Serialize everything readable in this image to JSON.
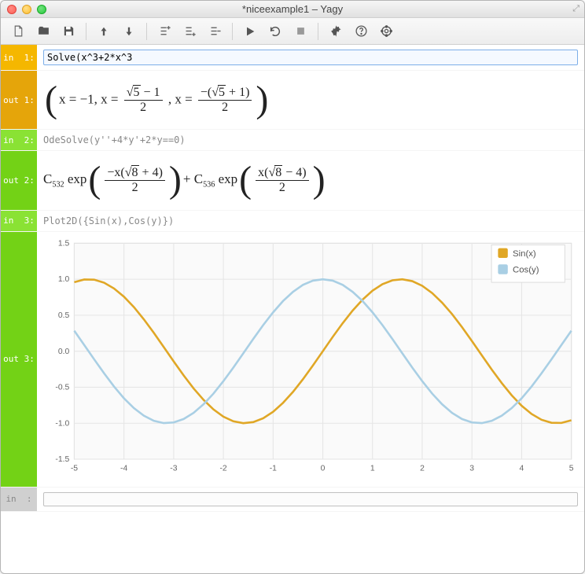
{
  "window": {
    "title": "*niceexample1 – Yagy"
  },
  "toolbar": {
    "new": "New",
    "open": "Open",
    "save": "Save",
    "up": "Up",
    "down": "Down",
    "insabove": "Insert Above",
    "insbelow": "Insert Below",
    "delcell": "Delete Cell",
    "run": "Run",
    "reload": "Reload",
    "stop": "Stop",
    "settings": "Settings",
    "help": "Help",
    "target": "Kernel"
  },
  "cells": {
    "in1_label": "in  1:",
    "in1_value": "Solve(x^3+2*x^3",
    "out1_label": "out 1:",
    "in2_label": "in  2:",
    "in2_value": "OdeSolve(y''+4*y'+2*y==0)",
    "out2_label": "out 2:",
    "in3_label": "in  3:",
    "in3_value": "Plot2D({Sin(x),Cos(y)})",
    "out3_label": "out 3:",
    "in_next_label": "in  :"
  },
  "chart_data": {
    "type": "line",
    "x": [
      -5,
      -4.8,
      -4.6,
      -4.4,
      -4.2,
      -4,
      -3.8,
      -3.6,
      -3.4,
      -3.2,
      -3,
      -2.8,
      -2.6,
      -2.4,
      -2.2,
      -2,
      -1.8,
      -1.6,
      -1.4,
      -1.2,
      -1,
      -0.8,
      -0.6,
      -0.4,
      -0.2,
      0,
      0.2,
      0.4,
      0.6,
      0.8,
      1,
      1.2,
      1.4,
      1.6,
      1.8,
      2,
      2.2,
      2.4,
      2.6,
      2.8,
      3,
      3.2,
      3.4,
      3.6,
      3.8,
      4,
      4.2,
      4.4,
      4.6,
      4.8,
      5
    ],
    "series": [
      {
        "name": "Sin(x)",
        "color": "#e0a726",
        "values": [
          0.959,
          0.996,
          0.994,
          0.952,
          0.872,
          0.757,
          0.612,
          0.443,
          0.256,
          0.058,
          -0.141,
          -0.335,
          -0.516,
          -0.675,
          -0.808,
          -0.909,
          -0.974,
          -1.0,
          -0.985,
          -0.932,
          -0.841,
          -0.717,
          -0.565,
          -0.389,
          -0.199,
          0.0,
          0.199,
          0.389,
          0.565,
          0.717,
          0.841,
          0.932,
          0.985,
          1.0,
          0.974,
          0.909,
          0.808,
          0.675,
          0.516,
          0.335,
          0.141,
          -0.058,
          -0.256,
          -0.443,
          -0.612,
          -0.757,
          -0.872,
          -0.952,
          -0.994,
          -0.996,
          -0.959
        ]
      },
      {
        "name": "Cos(y)",
        "color": "#a9cfe4",
        "values": [
          0.284,
          0.087,
          -0.112,
          -0.307,
          -0.49,
          -0.654,
          -0.79,
          -0.896,
          -0.967,
          -0.998,
          -0.99,
          -0.942,
          -0.857,
          -0.737,
          -0.589,
          -0.416,
          -0.227,
          -0.029,
          0.17,
          0.362,
          0.54,
          0.697,
          0.825,
          0.921,
          0.98,
          1.0,
          0.98,
          0.921,
          0.825,
          0.697,
          0.54,
          0.362,
          0.17,
          -0.029,
          -0.227,
          -0.416,
          -0.589,
          -0.737,
          -0.857,
          -0.942,
          -0.99,
          -0.998,
          -0.967,
          -0.896,
          -0.79,
          -0.654,
          -0.49,
          -0.307,
          -0.112,
          0.087,
          0.284
        ]
      }
    ],
    "xlim": [
      -5,
      5
    ],
    "ylim": [
      -1.5,
      1.5
    ],
    "xticks": [
      -5,
      -4,
      -3,
      -2,
      -1,
      0,
      1,
      2,
      3,
      4,
      5
    ],
    "yticks": [
      -1.5,
      -1.0,
      -0.5,
      0.0,
      0.5,
      1.0,
      1.5
    ],
    "xlabel": "",
    "ylabel": "",
    "title": "",
    "legend_pos": "top-right"
  }
}
